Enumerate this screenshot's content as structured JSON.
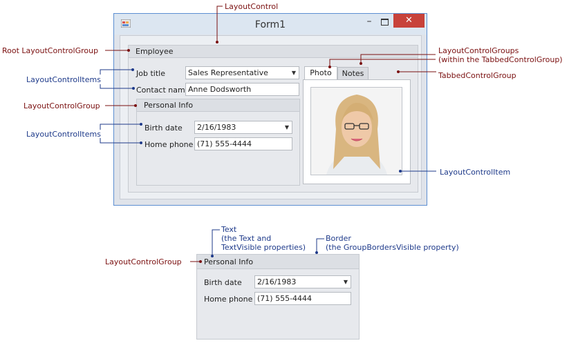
{
  "window": {
    "title": "Form1",
    "minimize_glyph": "–",
    "close_glyph": "✕",
    "icon": "app-icon"
  },
  "form": {
    "employee_group": "Employee",
    "job_title_label": "Job title",
    "job_title_value": "Sales Representative",
    "contact_name_label": "Contact name",
    "contact_name_value": "Anne Dodsworth",
    "personal_group": "Personal Info",
    "birth_date_label": "Birth date",
    "birth_date_value": "2/16/1983",
    "home_phone_label": "Home phone",
    "home_phone_value": "(71) 555-4444",
    "tabs": [
      "Photo",
      "Notes"
    ],
    "dropdown_glyph": "▼"
  },
  "detail": {
    "group_title": "Personal Info",
    "birth_date_label": "Birth date",
    "birth_date_value": "2/16/1983",
    "home_phone_label": "Home phone",
    "home_phone_value": "(71) 555-4444"
  },
  "annotations": {
    "layout_control": "LayoutControl",
    "root_group": "Root LayoutControlGroup",
    "items_top": "LayoutControlItems",
    "group_mid": "LayoutControlGroup",
    "items_mid": "LayoutControlItems",
    "tab_groups": "LayoutControlGroups\n(within the TabbedControlGroup)",
    "tabbed_group": "TabbedControlGroup",
    "photo_item": "LayoutControlItem",
    "text": "Text\n(the Text and\nTextVisible properties)",
    "border": "Border\n(the GroupBordersVisible property)",
    "bottom_group": "LayoutControlGroup"
  },
  "colors": {
    "annotation_red": "#7a0f0f",
    "annotation_blue": "#1e3a8a",
    "close_button": "#c8423a",
    "window_border": "#5b8ed1"
  }
}
